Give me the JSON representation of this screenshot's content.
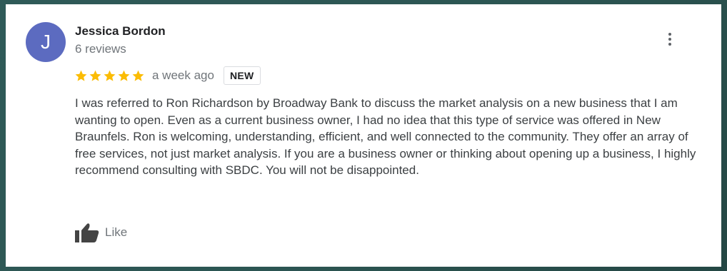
{
  "review": {
    "avatar_initial": "J",
    "avatar_color": "#5c6bc0",
    "reviewer_name": "Jessica Bordon",
    "review_count": "6 reviews",
    "rating": 5,
    "star_color": "#fbbc04",
    "time_ago": "a week ago",
    "badge": "NEW",
    "text": "I was referred to Ron Richardson by Broadway Bank to discuss the market analysis on a new business that I am wanting to open. Even as a current business owner, I had no idea that this type of service was offered in New Braunfels. Ron is welcoming, understanding, efficient, and well connected to the community. They offer an array of free services, not just market analysis. If you are a business owner or thinking about opening up a business, I highly recommend consulting with SBDC. You will not be disappointed.",
    "like_label": "Like",
    "more_icon": "more-vert-icon",
    "like_icon": "thumbs-up-icon"
  }
}
